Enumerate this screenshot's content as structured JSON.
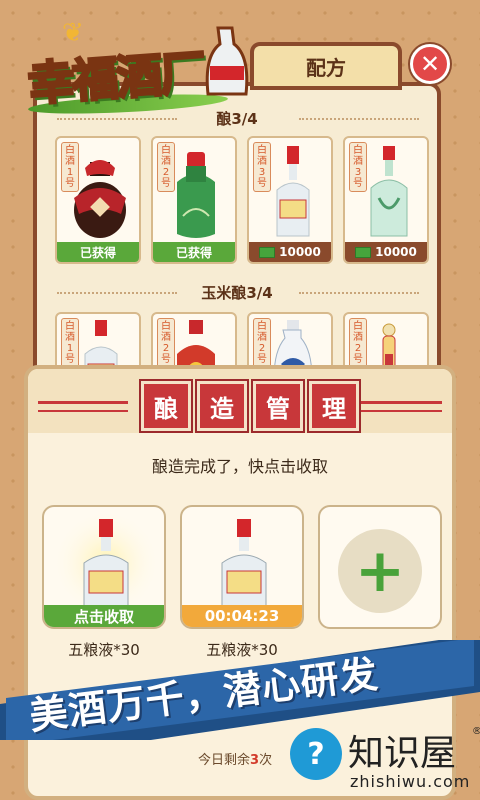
{
  "logo": {
    "title": "幸福酒厂"
  },
  "tab": {
    "label": "配方"
  },
  "close": {
    "label": "✕"
  },
  "sections": [
    {
      "title": "酿3/4"
    },
    {
      "title": "玉米酿3/4"
    }
  ],
  "row1": [
    {
      "label": "白酒1号",
      "status": "已获得",
      "type": "got",
      "bottle": "jar"
    },
    {
      "label": "白酒2号",
      "status": "已获得",
      "type": "got",
      "bottle": "green"
    },
    {
      "label": "白酒3号",
      "status": "10000",
      "type": "price",
      "bottle": "white-red"
    },
    {
      "label": "白酒3号",
      "status": "10000",
      "type": "price",
      "bottle": "celadon"
    }
  ],
  "row2": [
    {
      "label": "白酒1号",
      "bottle": "white-red"
    },
    {
      "label": "白酒2号",
      "bottle": "red"
    },
    {
      "label": "白酒2号",
      "bottle": "blue-white"
    },
    {
      "label": "白酒2号",
      "bottle": "gold"
    }
  ],
  "brew": {
    "title_chars": [
      "酿",
      "造",
      "管",
      "理"
    ],
    "message": "酿造完成了，快点击收取",
    "slots": [
      {
        "bar": "点击收取",
        "bar_type": "collect",
        "name": "五粮液*30"
      },
      {
        "bar": "00:04:23",
        "bar_type": "timer",
        "name": "五粮液*30"
      }
    ],
    "remaining_prefix": "今日剩余",
    "remaining_count": "3",
    "remaining_suffix": "次"
  },
  "banner": {
    "text": "美酒万千，潜心研发"
  },
  "watermark": {
    "name": "知识屋",
    "site": "zhishiwu.com",
    "reg": "®",
    "icon": "?"
  },
  "colors": {
    "panel_border": "#8a4a2c",
    "green": "#5aa83a",
    "red": "#c8373a",
    "orange": "#f2a93b",
    "banner": "#2c66a8"
  }
}
